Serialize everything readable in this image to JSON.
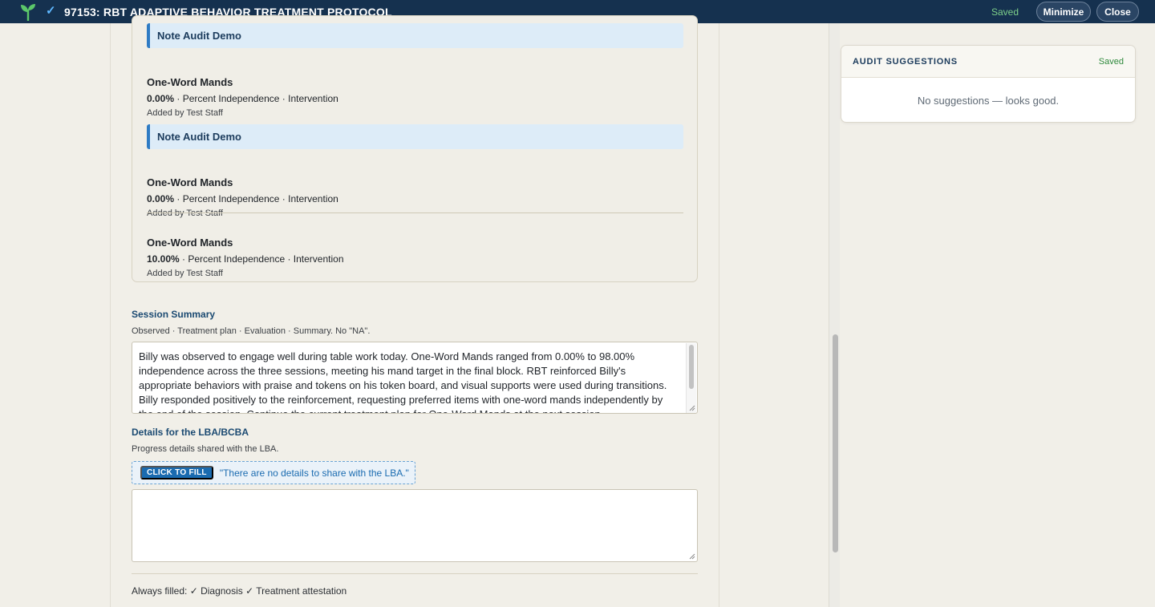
{
  "header": {
    "title": "97153: RBT ADAPTIVE BEHAVIOR TREATMENT PROTOCOL",
    "saved": "Saved",
    "minimize_label": "Minimize",
    "close_label": "Close"
  },
  "notes": {
    "groups": [
      {
        "heading": "Note Audit Demo",
        "entries": [
          {
            "name": "One-Word Mands",
            "value": "0.00%",
            "details": " · Percent Independence · Intervention",
            "added_by": "Added by Test Staff"
          }
        ]
      },
      {
        "heading": "Note Audit Demo",
        "entries": [
          {
            "name": "One-Word Mands",
            "value": "0.00%",
            "details": " · Percent Independence · Intervention",
            "added_by": "Added by Test Staff"
          },
          {
            "name": "One-Word Mands",
            "value": "10.00%",
            "details": " · Percent Independence · Intervention",
            "added_by": "Added by Test Staff"
          }
        ]
      }
    ]
  },
  "session_summary": {
    "title": "Session Summary",
    "hint": "Observed · Treatment plan · Evaluation · Summary. No \"NA\".",
    "text": "Billy was observed to engage well during table work today. One-Word Mands ranged from 0.00% to 98.00% independence across the three sessions, meeting his mand target in the final block. RBT reinforced Billy's appropriate behaviors with praise and tokens on his token board, and visual supports were used during transitions. Billy responded positively to the reinforcement, requesting preferred items with one-word mands independently by the end of the session. Continue the current treatment plan for One-Word Mands at the next session."
  },
  "lba_details": {
    "title": "Details for the LBA/BCBA",
    "hint": "Progress details shared with the LBA.",
    "fill_button": "CLICK TO FILL",
    "fill_suggestion": "\"There are no details to share with the LBA.\"",
    "value": ""
  },
  "footer": {
    "always_filled": "Always filled: ✓ Diagnosis ✓ Treatment attestation"
  },
  "audit": {
    "title": "AUDIT SUGGESTIONS",
    "saved": "Saved",
    "empty_message": "No suggestions — looks good."
  },
  "colors": {
    "topbar": "#15314f",
    "accent": "#1a6bb0",
    "saved_green": "#7ed08a"
  }
}
